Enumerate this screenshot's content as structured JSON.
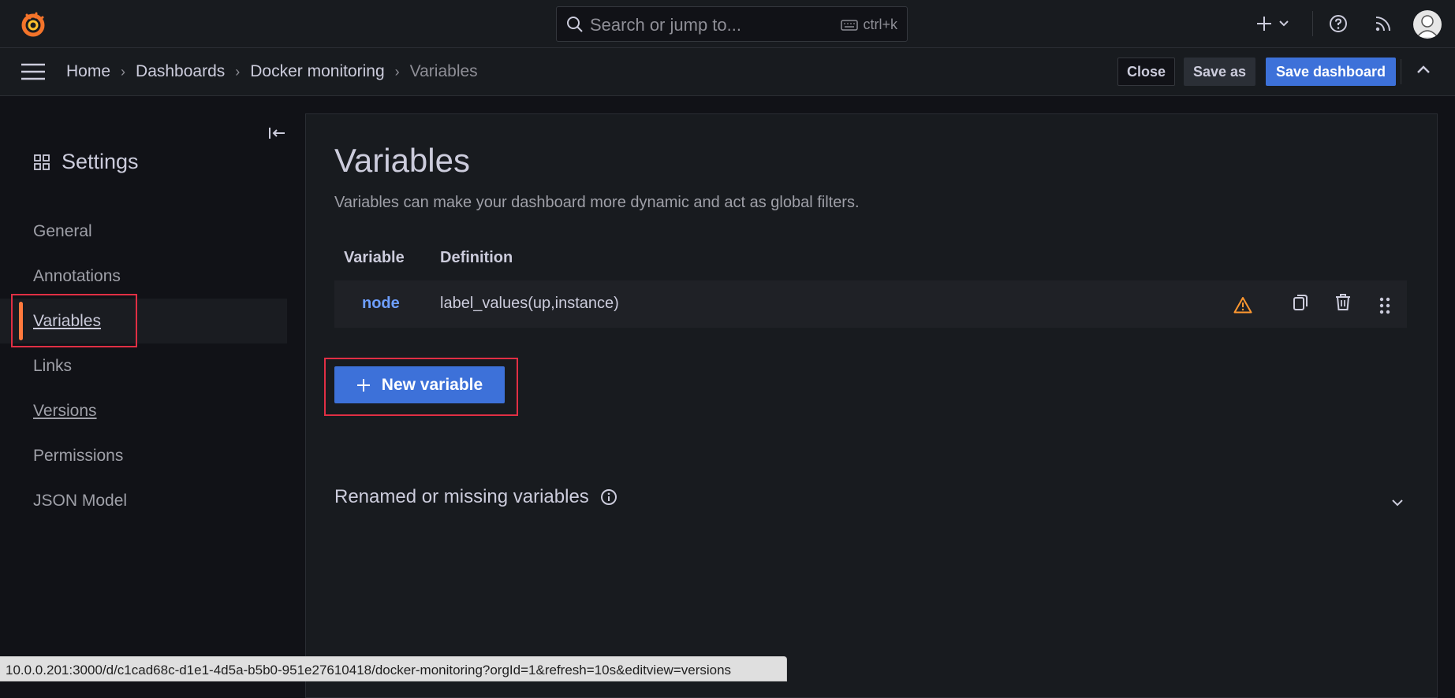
{
  "topbar": {
    "search_placeholder": "Search or jump to...",
    "shortcut": "ctrl+k"
  },
  "breadcrumbs": [
    "Home",
    "Dashboards",
    "Docker monitoring",
    "Variables"
  ],
  "toolbar": {
    "close_label": "Close",
    "save_as_label": "Save as",
    "save_dashboard_label": "Save dashboard"
  },
  "sidebar": {
    "title": "Settings",
    "items": [
      {
        "label": "General"
      },
      {
        "label": "Annotations"
      },
      {
        "label": "Variables",
        "active": true
      },
      {
        "label": "Links"
      },
      {
        "label": "Versions"
      },
      {
        "label": "Permissions"
      },
      {
        "label": "JSON Model"
      }
    ]
  },
  "main": {
    "title": "Variables",
    "description": "Variables can make your dashboard more dynamic and act as global filters.",
    "table": {
      "headers": [
        "Variable",
        "Definition"
      ],
      "rows": [
        {
          "name": "node",
          "definition": "label_values(up,instance)"
        }
      ]
    },
    "new_variable_label": "New variable",
    "renamed_section_label": "Renamed or missing variables"
  },
  "status_url": "10.0.0.201:3000/d/c1cad68c-d1e1-4d5a-b5b0-951e27610418/docker-monitoring?orgId=1&refresh=10s&editview=versions",
  "colors": {
    "primary": "#3d71d9",
    "active_bar": "#ff7a3d",
    "warning": "#ff9830",
    "highlight_box": "#e02f44",
    "variable_link": "#6e9fff"
  }
}
